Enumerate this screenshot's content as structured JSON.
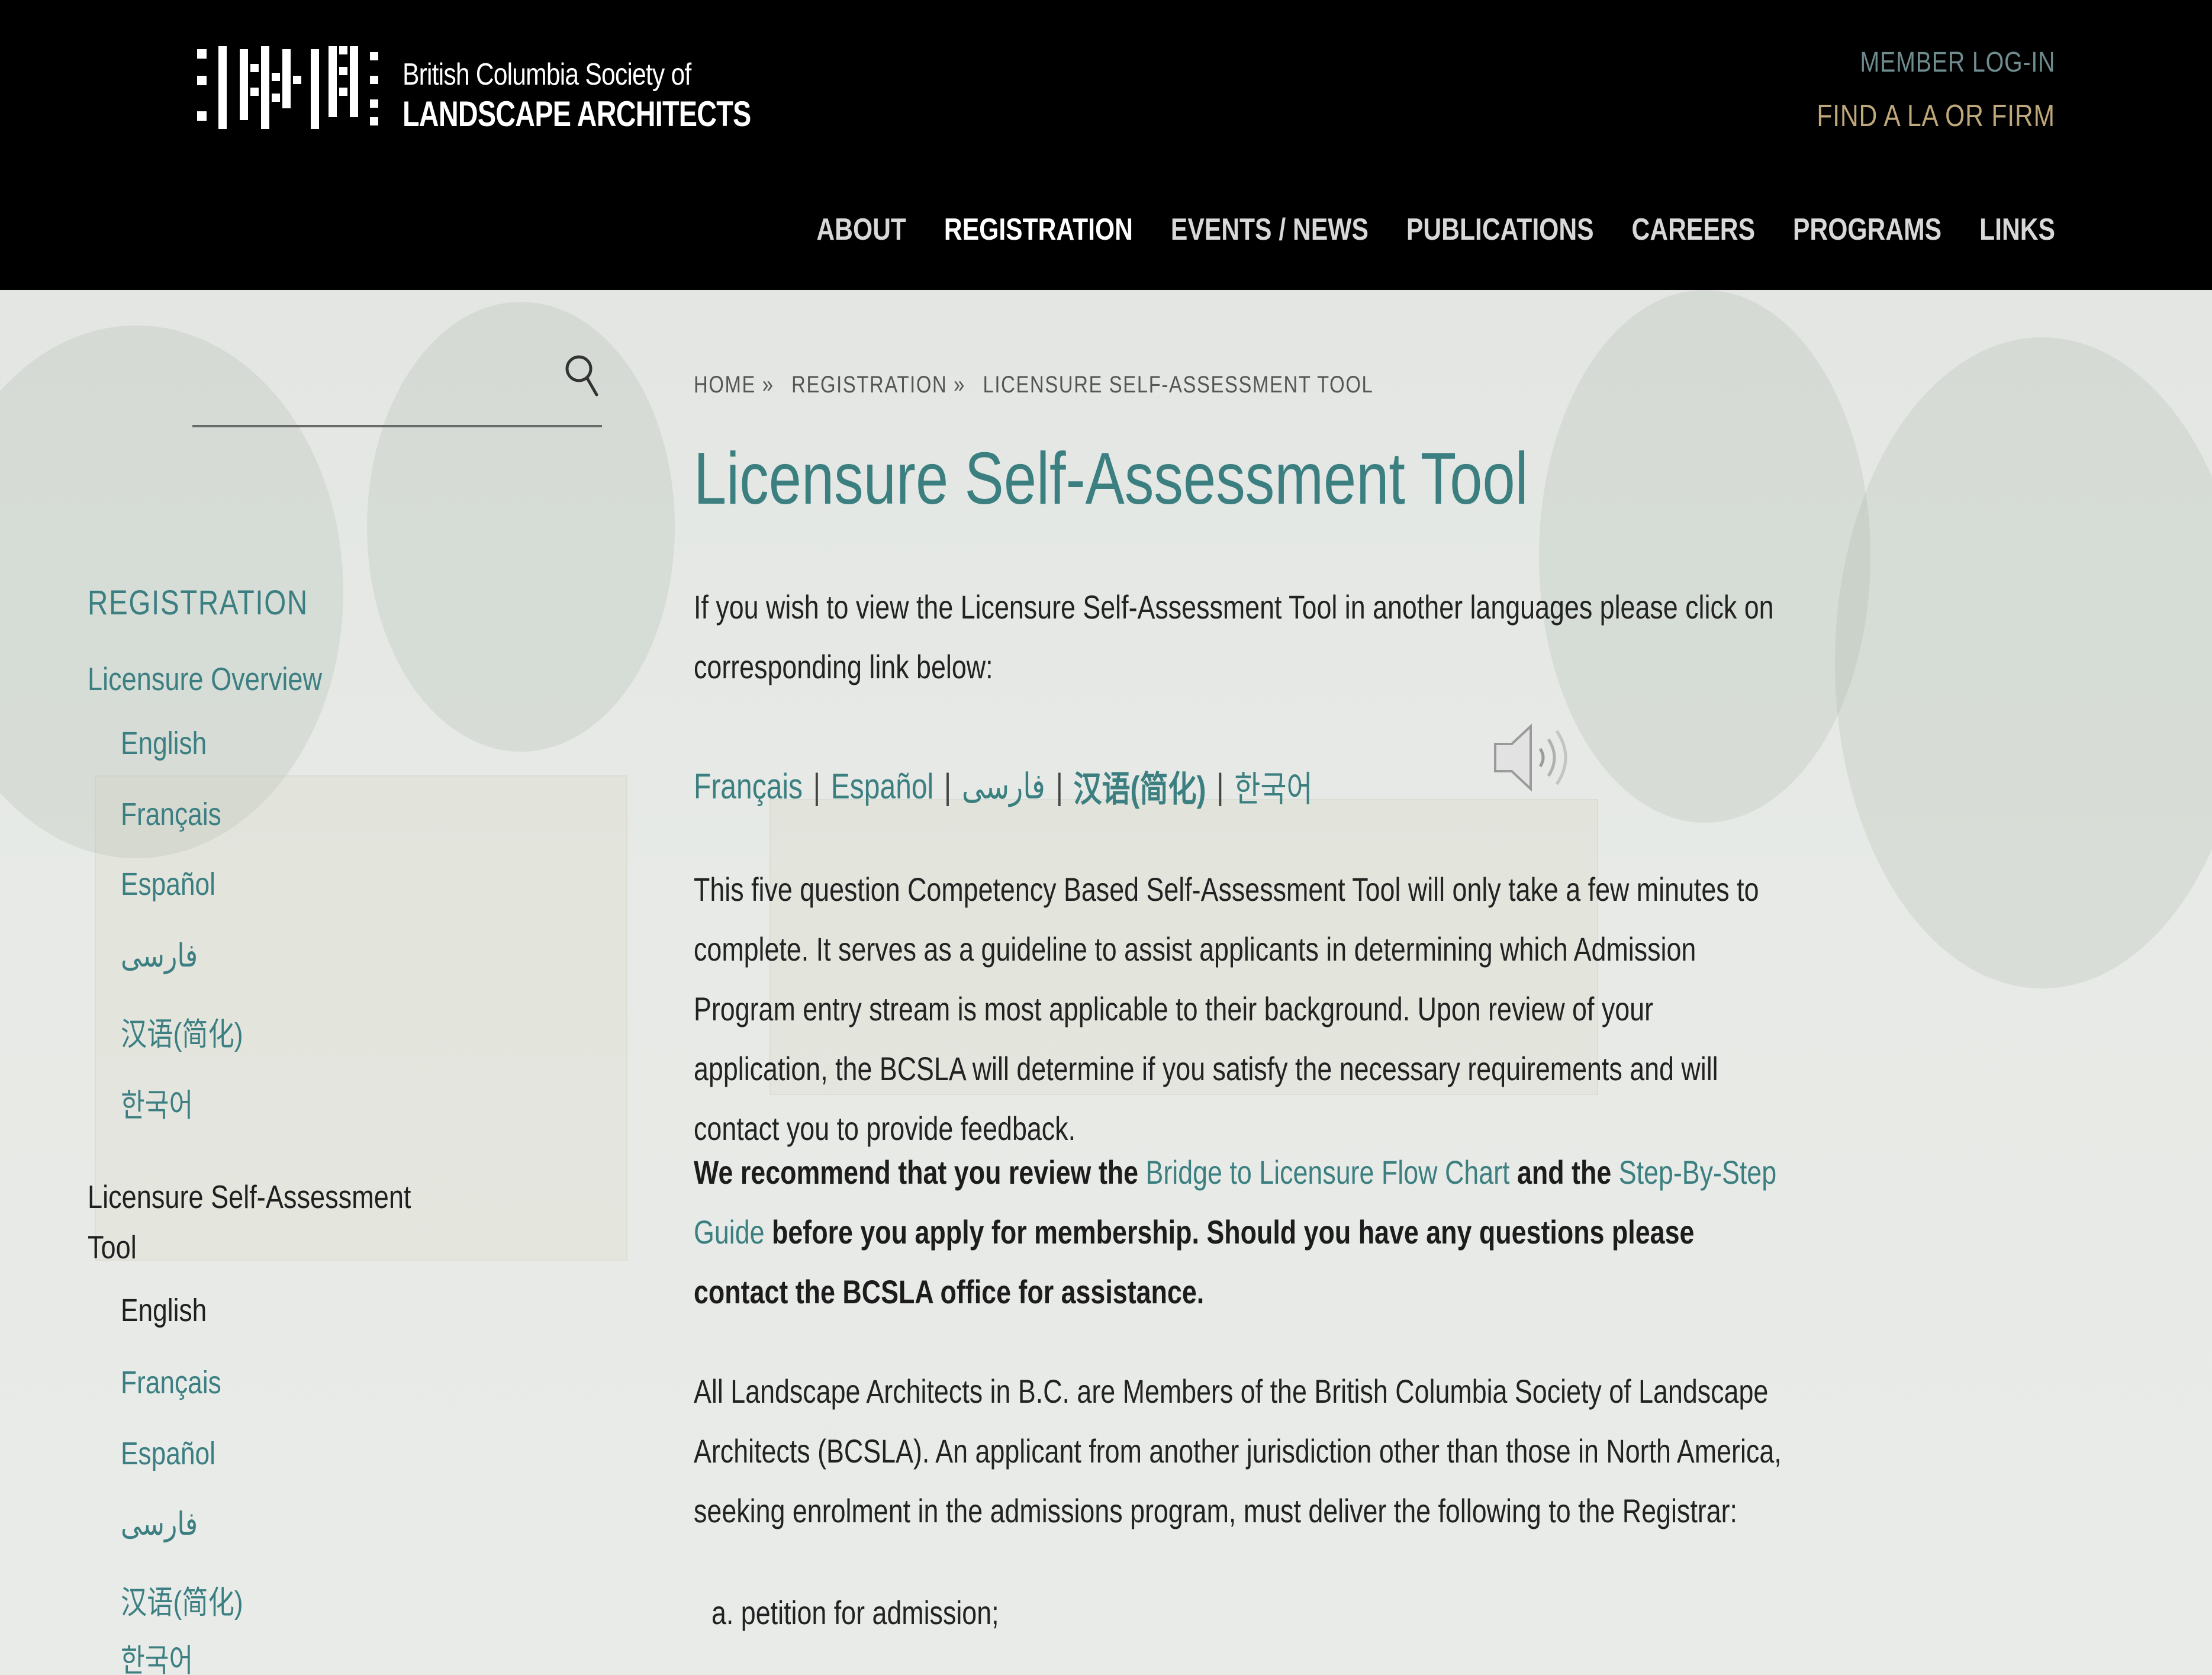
{
  "header": {
    "logo_line1": "British Columbia Society of",
    "logo_line2": "LANDSCAPE ARCHITECTS",
    "member_login": "MEMBER LOG-IN",
    "find_la": "FIND A LA OR FIRM",
    "nav": [
      "ABOUT",
      "REGISTRATION",
      "EVENTS / NEWS",
      "PUBLICATIONS",
      "CAREERS",
      "PROGRAMS",
      "LINKS"
    ],
    "active_nav": "REGISTRATION"
  },
  "search": {
    "placeholder": ""
  },
  "breadcrumb": [
    "HOME »",
    "REGISTRATION »",
    "LICENSURE SELF-ASSESSMENT TOOL"
  ],
  "page_title": "Licensure Self-Assessment Tool",
  "sidebar": {
    "heading": "REGISTRATION",
    "section1": "Licensure Overview",
    "section1_langs": [
      "English",
      "Français",
      "Español",
      "فارسی",
      "汉语(简化)",
      "한국어"
    ],
    "section2_line1": "Licensure Self-Assessment",
    "section2_line2": "Tool",
    "section2_langs": [
      "English",
      "Français",
      "Español",
      "فارسی",
      "汉语(简化)",
      "한국어"
    ]
  },
  "content": {
    "intro": "If you wish to view the Licensure Self-Assessment Tool in another languages please click on corresponding link below:",
    "lang_links": [
      "Français",
      "Español",
      "فارسی",
      "汉语(简化)",
      "한국어"
    ],
    "lang_separator": "|",
    "para1": "This five question Competency Based Self-Assessment Tool will only take a few minutes to complete. It serves as a guideline to assist applicants in determining which Admission Program entry stream is most applicable to their background. Upon review of your application, the BCSLA will determine if you satisfy the necessary requirements and will contact you to provide feedback.",
    "para2_a": "We recommend that you review the ",
    "para2_link1": "Bridge to Licensure Flow Chart",
    "para2_b": " and the ",
    "para2_link2": "Step-By-Step Guide",
    "para2_c": " before you apply for membership. Should you have any questions please contact the BCSLA office for assistance.",
    "para3": "All Landscape Architects in B.C. are Members of the British Columbia Society of Landscape Architects (BCSLA). An applicant from another jurisdiction other than those in North America, seeking enrolment in the admissions program, must deliver the following to the Registrar:",
    "list_a": "a. petition for admission;"
  },
  "colors": {
    "accent": "#3b7f80",
    "header_bg": "#000000",
    "find_la": "#bfa87a",
    "member_login": "#6f8c8f"
  },
  "icons": {
    "search": "search-icon",
    "speaker": "speaker-icon"
  }
}
